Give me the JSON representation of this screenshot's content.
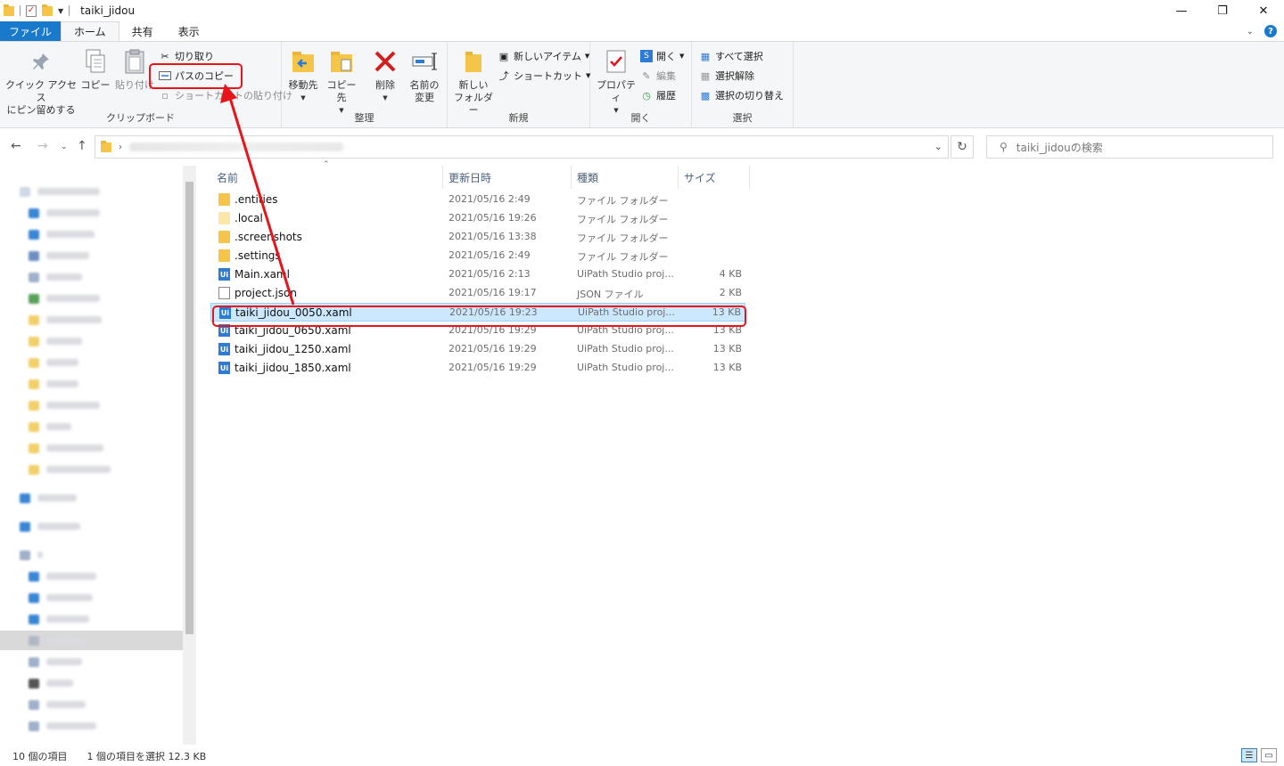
{
  "window": {
    "title": "taiki_jidou",
    "minimize": "—",
    "restore": "❐",
    "close": "✕"
  },
  "tabs": {
    "file": "ファイル",
    "home": "ホーム",
    "share": "共有",
    "view": "表示"
  },
  "ribbon": {
    "clipboard": {
      "label": "クリップボード",
      "pin_line1": "クイック アクセス",
      "pin_line2": "にピン留めする",
      "copy": "コピー",
      "paste": "貼り付け",
      "cut": "切り取り",
      "copy_path": "パスのコピー",
      "paste_shortcut": "ショートカットの貼り付け"
    },
    "organize": {
      "label": "整理",
      "move_to": "移動先",
      "copy_to": "コピー先",
      "delete": "削除",
      "rename_line1": "名前の",
      "rename_line2": "変更"
    },
    "new": {
      "label": "新規",
      "new_folder_line1": "新しい",
      "new_folder_line2": "フォルダー",
      "new_item": "新しいアイテム",
      "easy_access": "ショートカット"
    },
    "open": {
      "label": "開く",
      "properties": "プロパティ",
      "open": "開く",
      "edit": "編集",
      "history": "履歴"
    },
    "select": {
      "label": "選択",
      "select_all": "すべて選択",
      "select_none": "選択解除",
      "invert": "選択の切り替え"
    }
  },
  "search": {
    "placeholder": "taiki_jidouの検索"
  },
  "columns": {
    "name": "名前",
    "date": "更新日時",
    "type": "種類",
    "size": "サイズ"
  },
  "files": [
    {
      "name": ".entities",
      "date": "2021/05/16 2:49",
      "type": "ファイル フォルダー",
      "size": "",
      "icon": "folder-icon"
    },
    {
      "name": ".local",
      "date": "2021/05/16 19:26",
      "type": "ファイル フォルダー",
      "size": "",
      "icon": "folder-light-icon"
    },
    {
      "name": ".screenshots",
      "date": "2021/05/16 13:38",
      "type": "ファイル フォルダー",
      "size": "",
      "icon": "folder-icon"
    },
    {
      "name": ".settings",
      "date": "2021/05/16 2:49",
      "type": "ファイル フォルダー",
      "size": "",
      "icon": "folder-icon"
    },
    {
      "name": "Main.xaml",
      "date": "2021/05/16 2:13",
      "type": "UiPath Studio proj...",
      "size": "4 KB",
      "icon": "uipath-icon"
    },
    {
      "name": "project.json",
      "date": "2021/05/16 19:17",
      "type": "JSON ファイル",
      "size": "2 KB",
      "icon": "json-file-icon"
    },
    {
      "name": "taiki_jidou_0050.xaml",
      "date": "2021/05/16 19:23",
      "type": "UiPath Studio proj...",
      "size": "13 KB",
      "icon": "uipath-icon"
    },
    {
      "name": "taiki_jidou_0650.xaml",
      "date": "2021/05/16 19:29",
      "type": "UiPath Studio proj...",
      "size": "13 KB",
      "icon": "uipath-icon"
    },
    {
      "name": "taiki_jidou_1250.xaml",
      "date": "2021/05/16 19:29",
      "type": "UiPath Studio proj...",
      "size": "13 KB",
      "icon": "uipath-icon"
    },
    {
      "name": "taiki_jidou_1850.xaml",
      "date": "2021/05/16 19:29",
      "type": "UiPath Studio proj...",
      "size": "13 KB",
      "icon": "uipath-icon"
    }
  ],
  "selected_file": "taiki_jidou_0050.xaml",
  "status": {
    "item_count": "10 個の項目",
    "selection": "1 個の項目を選択  12.3 KB"
  },
  "colors": {
    "accent": "#1979ca",
    "selection": "#cce8ff",
    "annotation": "#e8141b",
    "folder": "#f5c54a"
  }
}
